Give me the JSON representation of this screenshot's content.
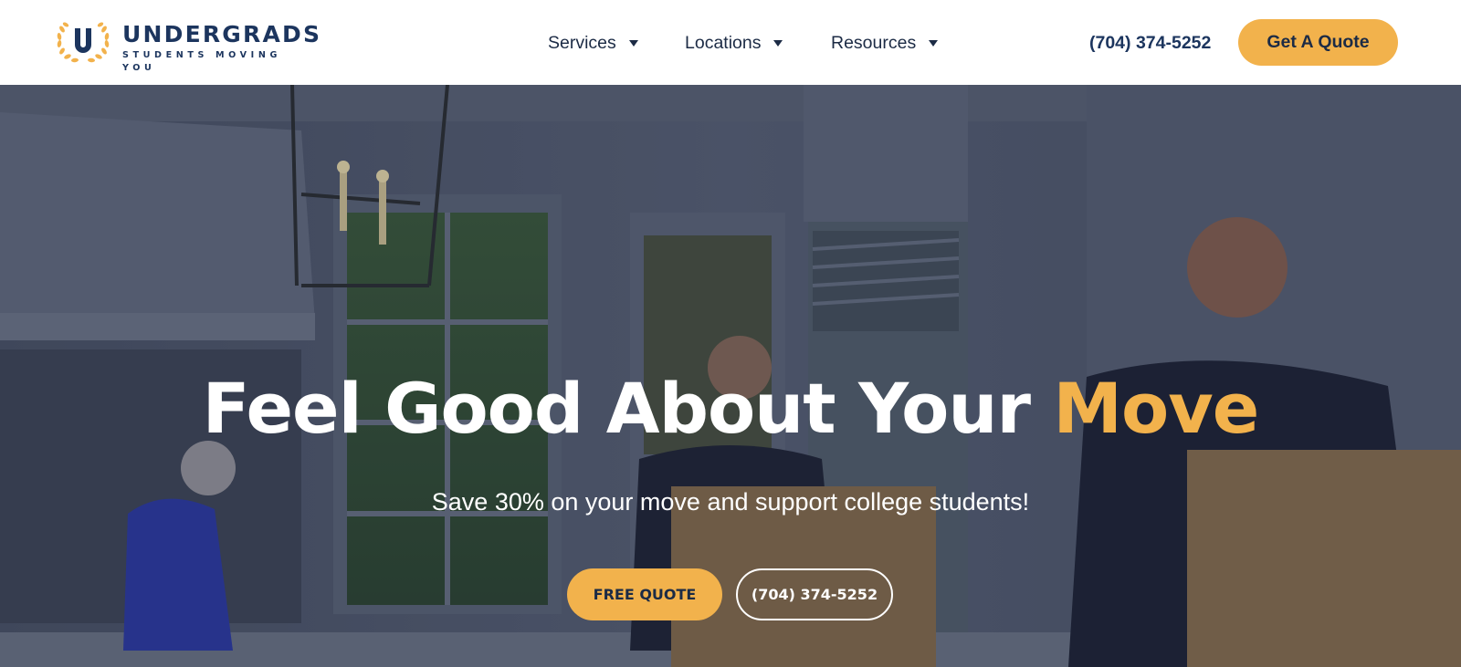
{
  "header": {
    "logo": {
      "wordmark": "UNDERGRADS",
      "tagline": "STUDENTS MOVING YOU",
      "emblem_letter": "U",
      "emblem_icon": "laurel-wreath-icon"
    },
    "nav": [
      {
        "label": "Services",
        "icon": "caret-down-icon"
      },
      {
        "label": "Locations",
        "icon": "caret-down-icon"
      },
      {
        "label": "Resources",
        "icon": "caret-down-icon"
      }
    ],
    "phone": "(704) 374-5252",
    "quote_button": "Get A Quote"
  },
  "hero": {
    "title_main": "Feel Good About Your",
    "title_accent": "Move",
    "subtitle": "Save 30% on your move and support college students!",
    "primary_cta": "FREE QUOTE",
    "secondary_cta": "(704) 374-5252"
  },
  "colors": {
    "brand_navy": "#1c355e",
    "accent_gold": "#f2b24c",
    "hero_overlay": "#1b2232"
  }
}
